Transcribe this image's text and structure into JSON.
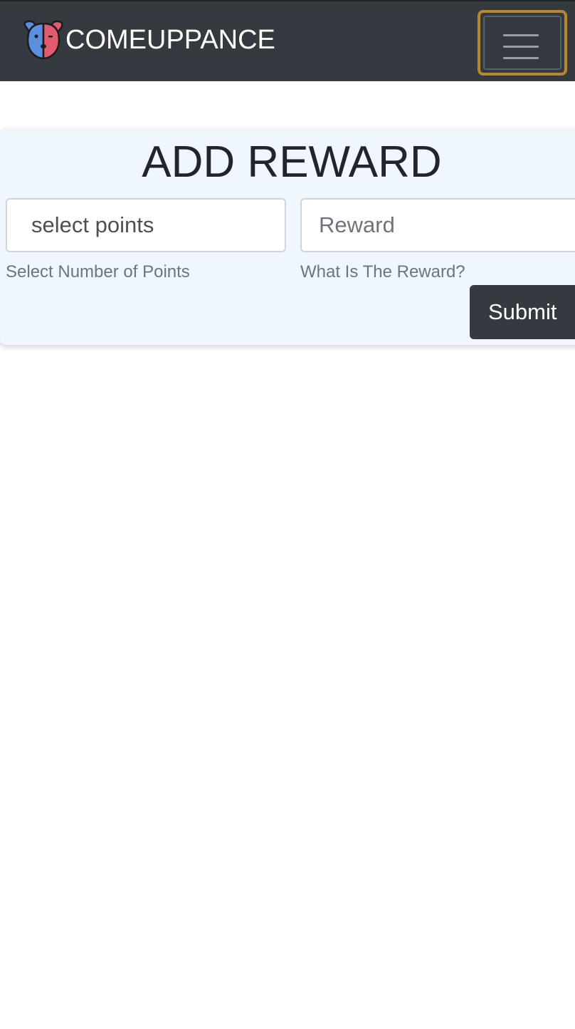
{
  "navbar": {
    "brand_text": "COMEUPPANCE",
    "logo_icon": "dog-face-icon",
    "menu_icon": "hamburger-menu-icon",
    "colors": {
      "background": "#343a40",
      "focus_outline": "#b8862d"
    }
  },
  "form": {
    "title": "ADD REWARD",
    "points_select": {
      "value": "select points",
      "help": "Select Number of Points"
    },
    "reward_input": {
      "placeholder": "Reward",
      "value": "",
      "help": "What Is The Reward?"
    },
    "submit_label": "Submit",
    "colors": {
      "card_background": "#eff6fe",
      "button_background": "#343a40"
    }
  }
}
